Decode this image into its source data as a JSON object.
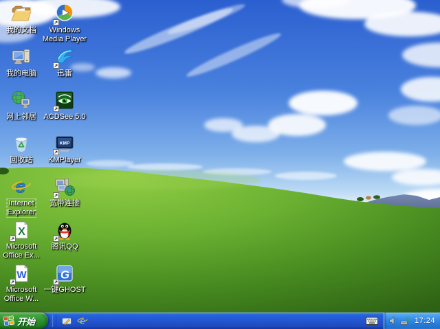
{
  "desktop": {
    "icons_left": [
      {
        "id": "my-documents",
        "label": "我的文档"
      },
      {
        "id": "my-computer",
        "label": "我的电脑"
      },
      {
        "id": "my-network-places",
        "label": "网上邻居"
      },
      {
        "id": "recycle-bin",
        "label": "回收站"
      },
      {
        "id": "internet-explorer",
        "label": "Internet\nExplorer",
        "selected": true,
        "art_text": "e"
      },
      {
        "id": "ms-office-excel",
        "label": "Microsoft\nOffice Ex...",
        "art_text": "X"
      },
      {
        "id": "ms-office-word",
        "label": "Microsoft\nOffice W...",
        "art_text": "W"
      }
    ],
    "icons_right": [
      {
        "id": "windows-media-player",
        "label": "Windows\nMedia Player"
      },
      {
        "id": "xunlei",
        "label": "迅雷"
      },
      {
        "id": "acdsee",
        "label": "ACDSee 5.0"
      },
      {
        "id": "kmplayer",
        "label": "KMPlayer",
        "art_text": "KMP"
      },
      {
        "id": "broadband-connection",
        "label": "宽带连接"
      },
      {
        "id": "tencent-qq",
        "label": "腾讯QQ"
      },
      {
        "id": "yijian-ghost",
        "label": "一键GHOST",
        "art_text": "G"
      }
    ]
  },
  "taskbar": {
    "start_label": "开始",
    "quick_launch": [
      {
        "name": "show-desktop"
      },
      {
        "name": "internet-explorer",
        "art_text": "e"
      }
    ],
    "tray": {
      "icons": [
        {
          "name": "volume"
        },
        {
          "name": "safely-remove-hardware"
        }
      ],
      "clock": "17:24"
    }
  },
  "colors": {
    "taskbar_blue": "#2457d0",
    "start_green": "#2f9231",
    "tray_blue": "#2e89e5",
    "sky_top": "#2b5fd0",
    "grass_highlight": "#8cc63f",
    "grass_dark": "#2f6315"
  }
}
